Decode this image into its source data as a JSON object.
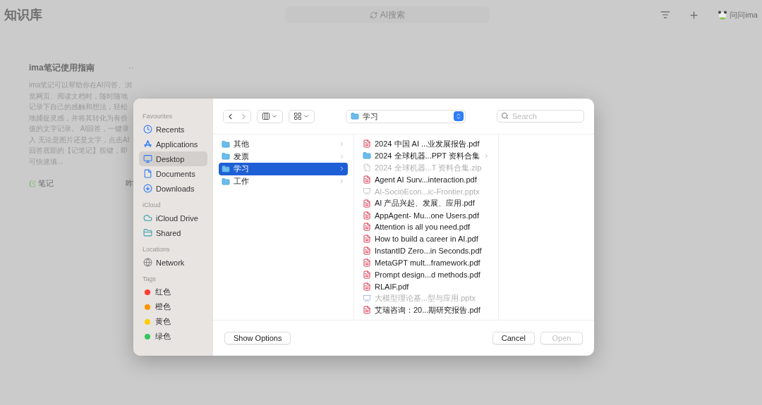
{
  "app": {
    "title": "知识库",
    "search": {
      "placeholder": "AI搜索"
    },
    "ask_label": "问问ima",
    "note": {
      "title": "ima笔记使用指南",
      "more": "··",
      "body": "ima笔记可以帮助你在AI问答、浏览网页、阅读文档时，随时随地记录下自己的感触和想法，轻松地捕捉灵感，并将其转化为有价值的文字记录。 AI回答，一键录入 无论是图片还是文字，点击AI回答底部的【记笔记】按键，即可快速填...",
      "tag": "笔记",
      "date": "昨"
    }
  },
  "dialog": {
    "sidebar": [
      {
        "heading": "Favourites",
        "items": [
          {
            "label": "Recents",
            "kind": "recents",
            "selected": false
          },
          {
            "label": "Applications",
            "kind": "applications",
            "selected": false
          },
          {
            "label": "Desktop",
            "kind": "desktop",
            "selected": true
          },
          {
            "label": "Documents",
            "kind": "documents",
            "selected": false
          },
          {
            "label": "Downloads",
            "kind": "downloads",
            "selected": false
          }
        ]
      },
      {
        "heading": "iCloud",
        "items": [
          {
            "label": "iCloud Drive",
            "kind": "cloud",
            "selected": false
          },
          {
            "label": "Shared",
            "kind": "shared",
            "selected": false
          }
        ]
      },
      {
        "heading": "Locations",
        "items": [
          {
            "label": "Network",
            "kind": "network",
            "selected": false
          }
        ]
      },
      {
        "heading": "Tags",
        "items": [
          {
            "label": "红色",
            "kind": "tag",
            "color": "#ff3b30",
            "selected": false
          },
          {
            "label": "橙色",
            "kind": "tag",
            "color": "#ff9500",
            "selected": false
          },
          {
            "label": "黄色",
            "kind": "tag",
            "color": "#ffcc00",
            "selected": false
          },
          {
            "label": "绿色",
            "kind": "tag",
            "color": "#34c759",
            "selected": false
          }
        ]
      }
    ],
    "location": "学习",
    "search": {
      "placeholder": "Search"
    },
    "folders": [
      {
        "name": "其他",
        "selected": false
      },
      {
        "name": "发票",
        "selected": false
      },
      {
        "name": "学习",
        "selected": true
      },
      {
        "name": "工作",
        "selected": false
      }
    ],
    "files": [
      {
        "name": "2024 中国 AI ...业发展报告.pdf",
        "kind": "pdf",
        "disabled": false
      },
      {
        "name": "2024 全球机器...PPT 资料合集",
        "kind": "folder",
        "disabled": false
      },
      {
        "name": "2024 全球机器...T 资料合集.zip",
        "kind": "zip",
        "disabled": true
      },
      {
        "name": "Agent AI Surv...interaction.pdf",
        "kind": "pdf",
        "disabled": false
      },
      {
        "name": "AI-SocioEcon...ic-Frontier.pptx",
        "kind": "pptx",
        "disabled": true
      },
      {
        "name": "AI 产品兴起、发展、应用.pdf",
        "kind": "pdf",
        "disabled": false
      },
      {
        "name": "AppAgent- Mu...one Users.pdf",
        "kind": "pdf",
        "disabled": false
      },
      {
        "name": "Attention is all you need.pdf",
        "kind": "pdf",
        "disabled": false
      },
      {
        "name": "How to build a career in AI.pdf",
        "kind": "pdf",
        "disabled": false
      },
      {
        "name": "InstantID Zero...in Seconds.pdf",
        "kind": "pdf",
        "disabled": false
      },
      {
        "name": "MetaGPT mult...framework.pdf",
        "kind": "pdf",
        "disabled": false
      },
      {
        "name": "Prompt design...d methods.pdf",
        "kind": "pdf",
        "disabled": false
      },
      {
        "name": "RLAIF.pdf",
        "kind": "pdf",
        "disabled": false
      },
      {
        "name": "大模型理论基...型与应用.pptx",
        "kind": "keynote",
        "disabled": true
      },
      {
        "name": "艾瑞咨询：20...期研究报告.pdf",
        "kind": "pdf",
        "disabled": false
      }
    ],
    "buttons": [
      {
        "label": "Show Options",
        "disabled": false
      },
      {
        "label": "Cancel",
        "disabled": false
      },
      {
        "label": "Open",
        "disabled": true
      }
    ]
  }
}
